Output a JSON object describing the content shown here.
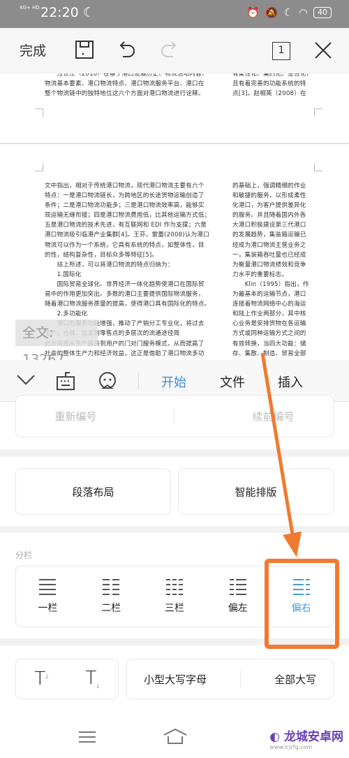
{
  "status": {
    "network": "4G+ HD",
    "time": "22:20",
    "battery": "40"
  },
  "toolbar": {
    "done": "完成",
    "page_count": "1"
  },
  "document": {
    "page1_left": [
      "　　汪长江（2010）在基于港口发展历史、物流活动内容、",
      "物流基本要素、港口物流特点、港口物流服务平台、港口在",
      "整个物流链中的独特地位这六个方面对港口物流进行诠释。"
    ],
    "page1_right": [
      "有柔性化、集约化、整合化，",
      "且有着完善的功能系统的特",
      "点[3]。赵相英（2008）在"
    ],
    "page2_left": [
      "文中指出，相对于传统港口物流，现代港口物流主要有六个",
      "特点：一是港口物流链长，为跨地区的长途货物运输创造了",
      "条件；二是港口物流功能多；三是港口物流效率高，能够实",
      "现运输无缝衔接；四是港口物流费用低，比其他运输方式低；",
      "五是港口物流的技术先进，有互联网和 EDI 作为支撑；六是",
      "港口物流吸引临港产业集群[4]。王芬，雷蕾(2008)认为港口",
      "物流可以作为一个系统，它具有系统的特点，如整体性，目",
      "的性，结构复杂性，目标众多等特征[5]。",
      "　　综上所述，可以将港口物流的特点归纳为：",
      "　　1.国际化",
      "　　国际贸易全球化、世界经济一体化趋势使港口在国际贸",
      "易中的作用更加突出。多数的港口主要提供国际物流服务，",
      "随着港口物流服务质量的提高，使得港口具有国际化的特点。",
      "　　2.多功能化",
      "　　港口的服务功能增强，推动了产销分工专业化，将过去",
      "生产、仓储、批发到零售点的多层次的流通途径简",
      "化为直接从生产服务到用户的门对门服务模式，从而提高了",
      "社会的整体生产力和经济效益，这正是借助了港口物流多功"
    ],
    "page2_right": [
      "的基础上，强调精细的作业",
      "和敏捷的服务，以形成柔性",
      "化港口，为客户提供差异化",
      "的服务。并且随着国内外各",
      "大港口积极建设第三代港口",
      "的发展趋势，集装箱运输已",
      "经成为港口物流主营业务之",
      "一，集装箱吞吐量也已经成",
      "为衡量港口物流绩效和竞争",
      "力水平的重要标志。",
      "　　Klin（1995）指出，作",
      "为最基本的运输节点，港口",
      "连接着物流网络中心的海运",
      "和陆上作业两部分，其中核",
      "心业务是安排货物在各运输",
      "方式或同种运输方式之间的",
      "有效转换，当四大功能：储",
      "存、集散、制造、贸易全部"
    ],
    "word_count": "全文: 13267"
  },
  "tabs": [
    {
      "label": "开始",
      "active": true
    },
    {
      "label": "文件"
    },
    {
      "label": "插入"
    }
  ],
  "panel": {
    "numbering": [
      "重新编号",
      "续前编号"
    ],
    "layout": [
      "段落布局",
      "智能排版"
    ],
    "columns_label": "分栏",
    "columns": [
      {
        "label": "一栏"
      },
      {
        "label": "二栏"
      },
      {
        "label": "三栏"
      },
      {
        "label": "偏左"
      },
      {
        "label": "偏右",
        "selected": true
      }
    ],
    "super_label": "T",
    "super_mark": "2",
    "case": [
      "小型大写字母",
      "全部大写"
    ]
  },
  "watermark": {
    "text": "龙城安卓网",
    "url": "www.lcjrfg.com"
  },
  "colors": {
    "accent": "#3b8fd4",
    "annotation": "#f07a30"
  }
}
